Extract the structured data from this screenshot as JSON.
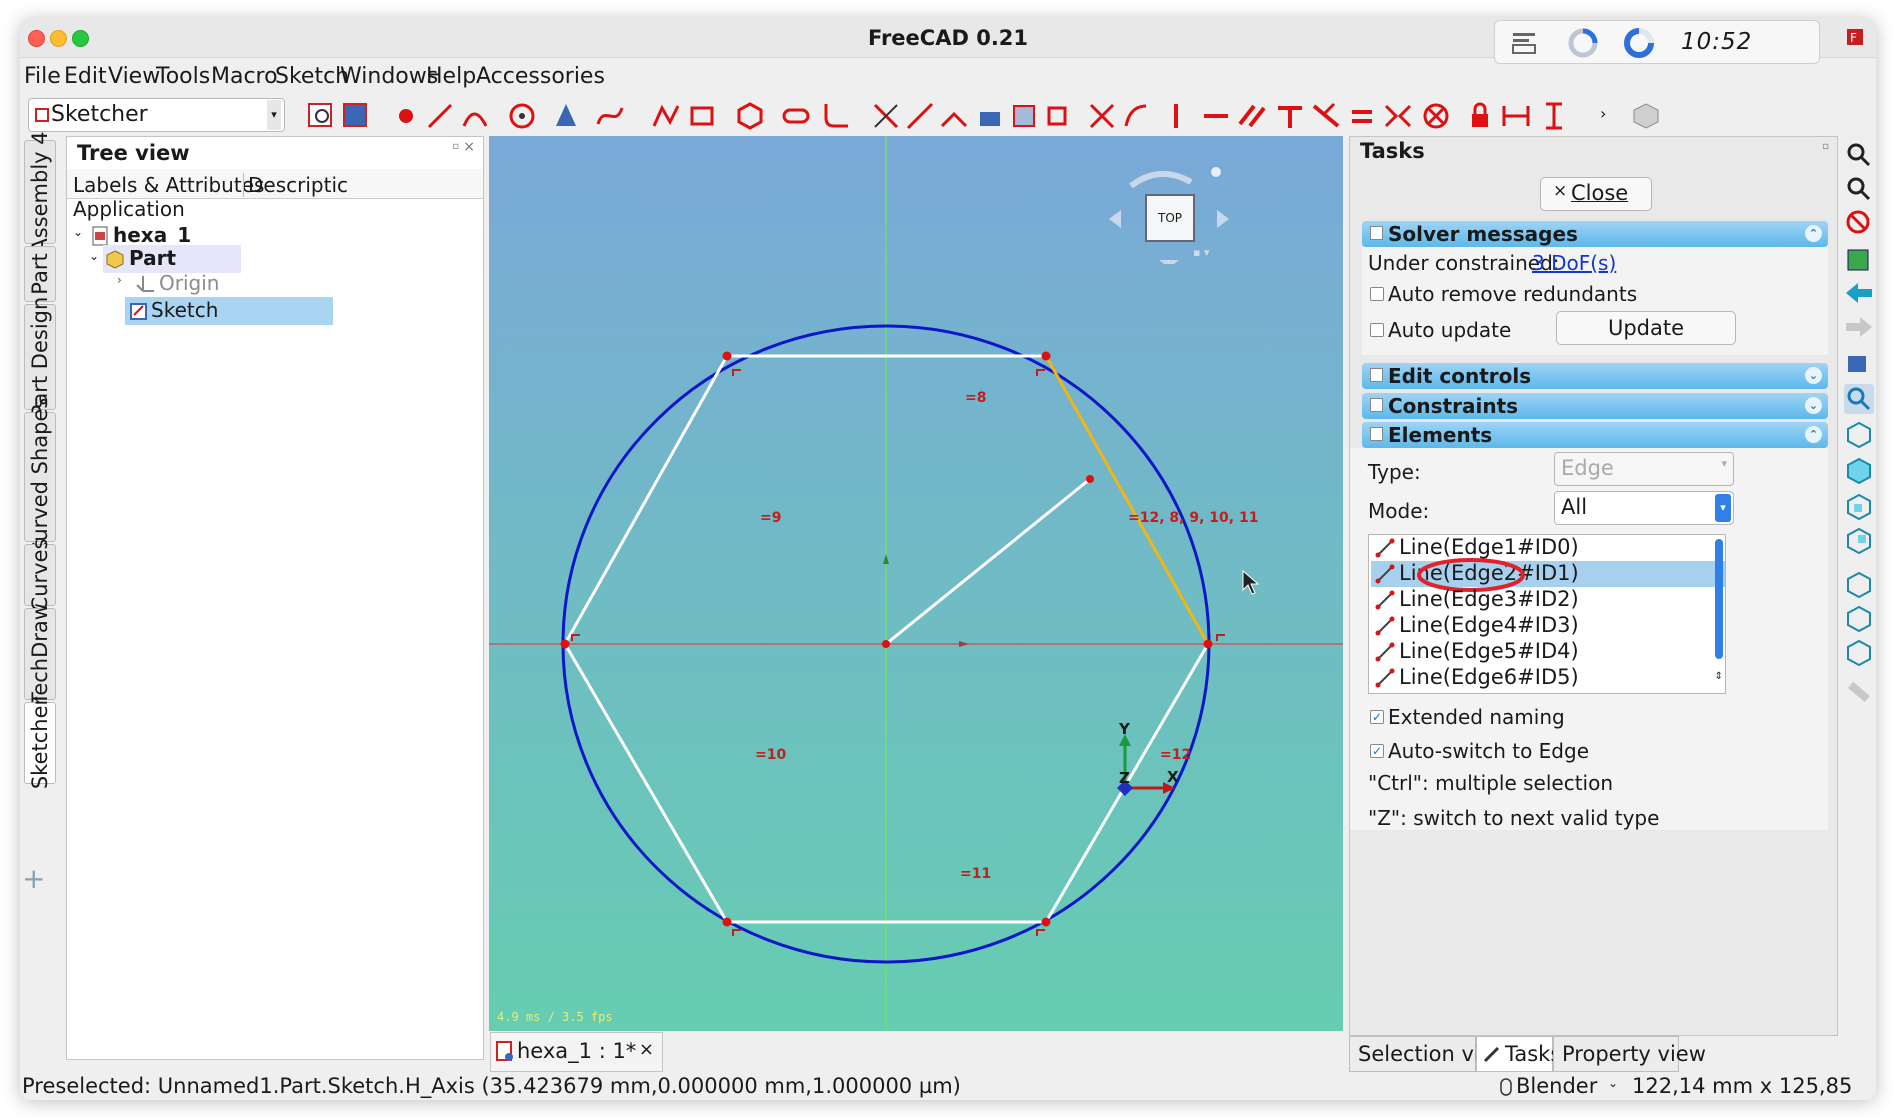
{
  "window": {
    "title": "FreeCAD 0.21"
  },
  "tray": {
    "clock": "10:52"
  },
  "menu": [
    "File",
    "Edit",
    "View",
    "Tools",
    "Macro",
    "Sketch",
    "Windows",
    "Help",
    "Accessories"
  ],
  "toolbar": {
    "workbench": "Sketcher"
  },
  "side_tabs": [
    "Assembly 4",
    "Part",
    "Part Design",
    "Curved Shapes",
    "Curves",
    "TechDraw",
    "Sketcher"
  ],
  "tree": {
    "title": "Tree view",
    "columns": [
      "Labels & Attributes",
      "Descriptic"
    ],
    "root": "Application",
    "items": [
      {
        "label": "hexa_1",
        "level": 0
      },
      {
        "label": "Part",
        "level": 1
      },
      {
        "label": "Origin",
        "level": 2
      },
      {
        "label": "Sketch",
        "level": 2
      }
    ]
  },
  "viewport": {
    "navcube_face": "TOP",
    "fps": "4.9 ms / 3.5 fps",
    "axes": {
      "x": "X",
      "y": "Y",
      "z": "Z"
    },
    "constraints": {
      "c8": "8",
      "c9": "9",
      "c10": "10",
      "c11": "11",
      "c12": "12",
      "c_multi": "12, 8, 9, 10, 11"
    }
  },
  "doc_tab": {
    "label": "hexa_1 : 1*",
    "close": "×"
  },
  "tasks": {
    "title": "Tasks",
    "close_button": "Close",
    "solver": {
      "title": "Solver messages",
      "status_label": "Under constrained:",
      "dof_link": "3 DoF(s)",
      "auto_remove": "Auto remove redundants",
      "auto_update": "Auto update",
      "update_button": "Update"
    },
    "edit_controls": "Edit controls",
    "constraints": "Constraints",
    "elements": {
      "title": "Elements",
      "type_label": "Type:",
      "type_value": "Edge",
      "mode_label": "Mode:",
      "mode_value": "All",
      "items": [
        "Line(Edge1#ID0)",
        "Line(Edge2#ID1)",
        "Line(Edge3#ID2)",
        "Line(Edge4#ID3)",
        "Line(Edge5#ID4)",
        "Line(Edge6#ID5)"
      ],
      "selected_index": 1,
      "extended_naming": "Extended naming",
      "auto_switch": "Auto-switch to Edge",
      "hint_ctrl": "\"Ctrl\": multiple selection",
      "hint_z": "\"Z\": switch to next valid type"
    }
  },
  "bottom_tabs": [
    "Selection view",
    "Tasks",
    "Property view"
  ],
  "status": {
    "message": "Preselected: Unnamed1.Part.Sketch.H_Axis (35.423679 mm,0.000000 mm,1.000000 µm)",
    "nav_style": "Blender",
    "dimensions": "122,14 mm x 125,85 mm"
  }
}
